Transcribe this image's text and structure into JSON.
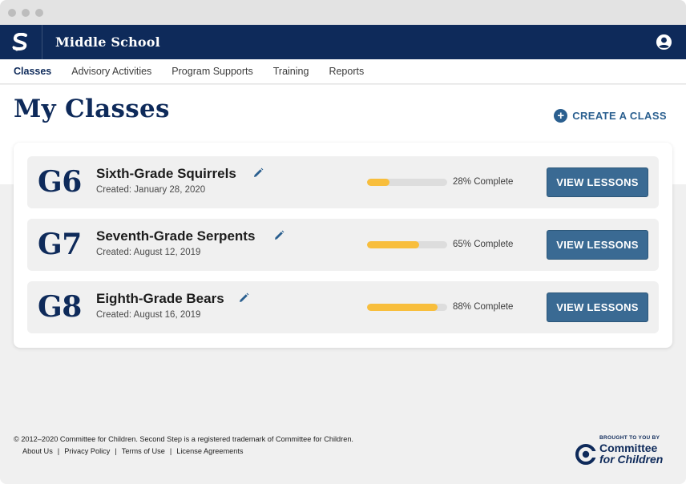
{
  "app": {
    "title": "Middle School"
  },
  "nav": {
    "tabs": [
      {
        "label": "Classes",
        "active": true
      },
      {
        "label": "Advisory Activities",
        "active": false
      },
      {
        "label": "Program Supports",
        "active": false
      },
      {
        "label": "Training",
        "active": false
      },
      {
        "label": "Reports",
        "active": false
      }
    ]
  },
  "page": {
    "title": "My Classes",
    "create_label": "CREATE A CLASS"
  },
  "classes": [
    {
      "grade": "G6",
      "name": "Sixth-Grade Squirrels",
      "created": "Created: January 28, 2020",
      "progress": 0.28,
      "progress_text": "28% Complete",
      "button": "VIEW LESSONS"
    },
    {
      "grade": "G7",
      "name": "Seventh-Grade Serpents",
      "created": "Created: August 12, 2019",
      "progress": 0.65,
      "progress_text": "65% Complete",
      "button": "VIEW LESSONS"
    },
    {
      "grade": "G8",
      "name": "Eighth-Grade Bears",
      "created": "Created: August 16, 2019",
      "progress": 0.88,
      "progress_text": "88% Complete",
      "button": "VIEW LESSONS"
    }
  ],
  "footer": {
    "copyright": "© 2012–2020 Committee for Children. Second Step is a registered trademark of Committee for Children.",
    "links": [
      "About Us",
      "Privacy Policy",
      "Terms of Use",
      "License Agreements"
    ],
    "separator": "|",
    "brought_by": "BROUGHT TO YOU BY",
    "org_line1": "Committee",
    "org_line2": "for Children"
  },
  "colors": {
    "navy": "#0e2a5a",
    "button_blue": "#3a6a93",
    "progress_yellow": "#f8be3c",
    "progress_track": "#dddddd"
  },
  "icons": {
    "logo": "second-step-s-logo",
    "account": "account-circle-icon",
    "create": "plus-circle-icon",
    "edit": "pencil-icon",
    "org_logo": "cfc-logo-icon"
  }
}
